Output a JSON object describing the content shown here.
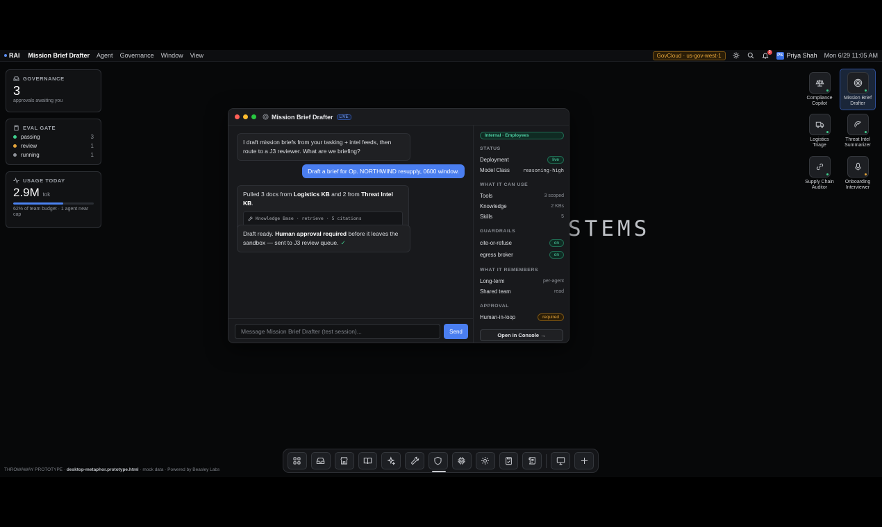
{
  "menubar": {
    "logo": "RAI",
    "app_name": "Mission Brief Drafter",
    "menus": [
      "Agent",
      "Governance",
      "Window",
      "View"
    ],
    "region": "GovCloud · us-gov-west-1",
    "notification_count": "3",
    "user_initials": "PS",
    "user_name": "Priya Shah",
    "clock": "Mon 6/29 11:05 AM"
  },
  "widgets": {
    "governance": {
      "title": "GOVERNANCE",
      "count": "3",
      "caption": "approvals awaiting you"
    },
    "eval_gate": {
      "title": "EVAL GATE",
      "rows": [
        {
          "label": "passing",
          "count": "3",
          "color": "#3fcf8e"
        },
        {
          "label": "review",
          "count": "1",
          "color": "#e5a53b"
        },
        {
          "label": "running",
          "count": "1",
          "color": "#8f939a"
        }
      ]
    },
    "usage": {
      "title": "USAGE TODAY",
      "value": "2.9M",
      "unit": "tok",
      "budget_fraction": 0.62,
      "caption": "62% of team budget · 1 agent near cap"
    }
  },
  "watermark": "STEMS",
  "window": {
    "title": "Mission Brief Drafter",
    "badge": "LIVE",
    "messages": {
      "m1": "I draft mission briefs from your tasking + intel feeds, then route to a J3 reviewer. What are we briefing?",
      "user": "Draft a brief for Op. NORTHWIND resupply, 0600 window.",
      "m3_a": "Pulled 3 docs from ",
      "m3_b": "Logistics KB",
      "m3_c": " and 2 from ",
      "m3_d": "Threat Intel KB",
      "m3_e": ".",
      "tool": "Knowledge Base · retrieve · 5 citations",
      "m4_a": "Draft ready. ",
      "m4_b": "Human approval required",
      "m4_c": " before it leaves the sandbox — sent to J3 review queue.",
      "m4_check": "✓"
    },
    "composer": {
      "placeholder": "Message Mission Brief Drafter (test session)...",
      "send": "Send"
    },
    "panel": {
      "access": "Internal · Employees",
      "status_title": "STATUS",
      "deployment_label": "Deployment",
      "deployment_value": "live",
      "model_label": "Model Class",
      "model_value": "reasoning-high",
      "can_use_title": "WHAT IT CAN USE",
      "tools_label": "Tools",
      "tools_value": "3 scoped",
      "knowledge_label": "Knowledge",
      "knowledge_value": "2 KBs",
      "skills_label": "Skills",
      "skills_value": "5",
      "guardrails_title": "GUARDRAILS",
      "g1_label": "cite-or-refuse",
      "g1_value": "on",
      "g2_label": "egress broker",
      "g2_value": "on",
      "remembers_title": "WHAT IT REMEMBERS",
      "lt_label": "Long-term",
      "lt_value": "per-agent",
      "st_label": "Shared team",
      "st_value": "read",
      "approval_title": "APPROVAL",
      "hil_label": "Human-in-loop",
      "hil_value": "required",
      "console_button": "Open in Console →"
    }
  },
  "desktop_icons": [
    {
      "line1": "Compliance",
      "line2": "Copilot"
    },
    {
      "line1": "Mission Brief",
      "line2": "Drafter"
    },
    {
      "line1": "Logistics",
      "line2": "Triage"
    },
    {
      "line1": "Threat Intel",
      "line2": "Summarizer"
    },
    {
      "line1": "Supply Chain",
      "line2": "Auditor"
    },
    {
      "line1": "Onboarding",
      "line2": "Interviewer"
    }
  ],
  "footer": {
    "prefix": "THROWAWAY PROTOTYPE · ",
    "file": "desktop-metaphor.prototype.html",
    "suffix": " · mock data · Powered by Beasley Labs"
  }
}
